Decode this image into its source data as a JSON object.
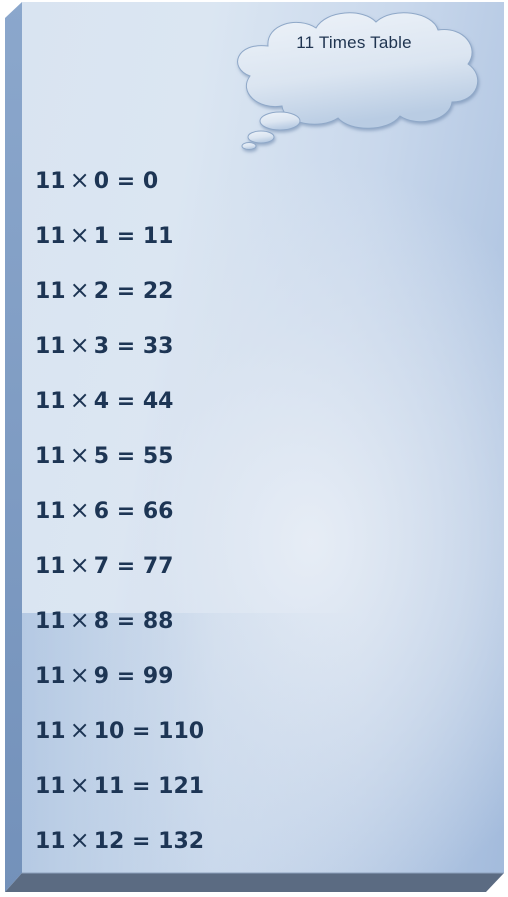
{
  "title": "11 Times Table",
  "multiplicand": 11,
  "multiply_symbol": "×",
  "equals_symbol": "=",
  "rows": [
    {
      "a": "11",
      "b": "0",
      "result": "0"
    },
    {
      "a": "11",
      "b": "1",
      "result": "11"
    },
    {
      "a": "11",
      "b": "2",
      "result": "22"
    },
    {
      "a": "11",
      "b": "3",
      "result": "33"
    },
    {
      "a": "11",
      "b": "4",
      "result": "44"
    },
    {
      "a": "11",
      "b": "5",
      "result": "55"
    },
    {
      "a": "11",
      "b": "6",
      "result": "66"
    },
    {
      "a": "11",
      "b": "7",
      "result": "77"
    },
    {
      "a": "11",
      "b": "8",
      "result": "88"
    },
    {
      "a": "11",
      "b": "9",
      "result": "99"
    },
    {
      "a": "11",
      "b": "10",
      "result": "110"
    },
    {
      "a": "11",
      "b": "11",
      "result": "121"
    },
    {
      "a": "11",
      "b": "12",
      "result": "132"
    }
  ],
  "colors": {
    "text": "#1d3554",
    "bevel_left": "#7f9cc2",
    "bevel_bottom": "#5a6a80"
  }
}
